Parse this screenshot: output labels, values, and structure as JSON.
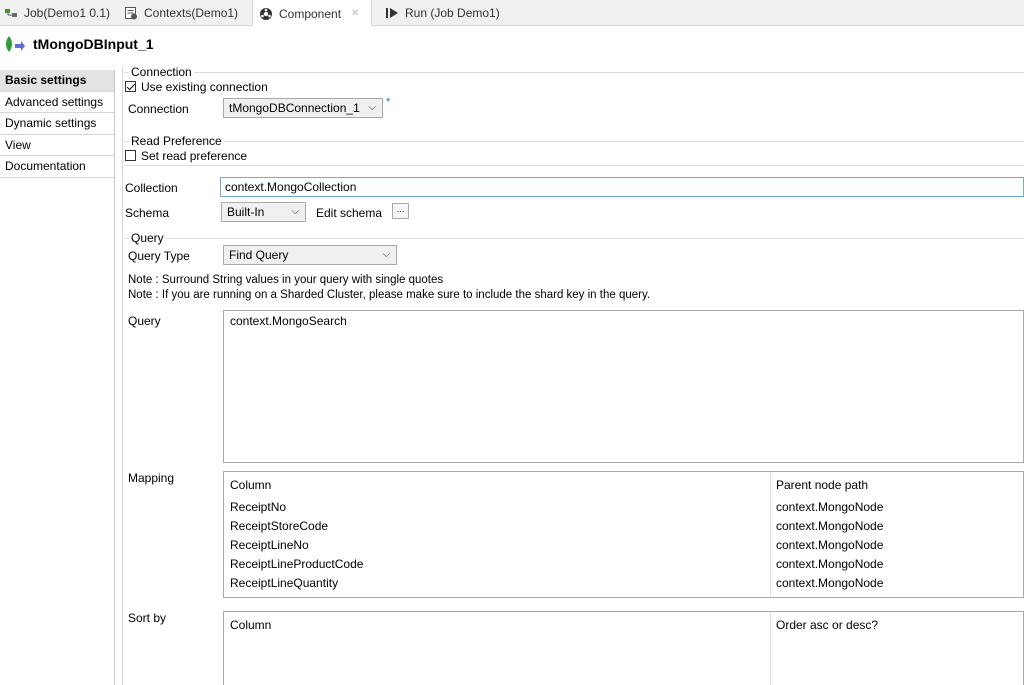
{
  "tabs": [
    {
      "label": "Job(Demo1 0.1)",
      "icon": "job-icon"
    },
    {
      "label": "Contexts(Demo1)",
      "icon": "contexts-icon"
    },
    {
      "label": "Component",
      "icon": "component-icon",
      "active": true
    },
    {
      "label": "Run (Job Demo1)",
      "icon": "run-icon"
    }
  ],
  "component": {
    "title": "tMongoDBInput_1"
  },
  "nav": [
    {
      "label": "Basic settings",
      "active": true
    },
    {
      "label": "Advanced settings"
    },
    {
      "label": "Dynamic settings"
    },
    {
      "label": "View"
    },
    {
      "label": "Documentation"
    }
  ],
  "connection": {
    "group_title": "Connection",
    "use_existing_label": "Use existing connection",
    "use_existing_checked": true,
    "connection_label": "Connection",
    "connection_value": "tMongoDBConnection_1",
    "required_mark": "*"
  },
  "read_preference": {
    "group_title": "Read Preference",
    "set_label": "Set read preference",
    "set_checked": false
  },
  "collection": {
    "label": "Collection",
    "value": "context.MongoCollection"
  },
  "schema": {
    "label": "Schema",
    "value": "Built-In",
    "edit_label": "Edit schema",
    "ellipsis": "..."
  },
  "query_group": {
    "group_title": "Query",
    "type_label": "Query Type",
    "type_value": "Find Query",
    "note1": "Note : Surround String values in your query with single quotes",
    "note2": "Note : If you are running on a Sharded Cluster, please make sure to include the shard key in the query.",
    "query_label": "Query",
    "query_value": "context.MongoSearch"
  },
  "mapping": {
    "label": "Mapping",
    "headers": [
      "Column",
      "Parent node path"
    ],
    "rows": [
      [
        "ReceiptNo",
        "context.MongoNode"
      ],
      [
        "ReceiptStoreCode",
        "context.MongoNode"
      ],
      [
        "ReceiptLineNo",
        "context.MongoNode"
      ],
      [
        "ReceiptLineProductCode",
        "context.MongoNode"
      ],
      [
        "ReceiptLineQuantity",
        "context.MongoNode"
      ]
    ]
  },
  "sort": {
    "label": "Sort by",
    "headers": [
      "Column",
      "Order asc or desc?"
    ]
  },
  "colors": {
    "accent": "#7aa6d6",
    "nav_active_bg": "#e3e3e3",
    "leaf_green": "#2e9e3a",
    "arrow_blue": "#5b6fd6"
  }
}
